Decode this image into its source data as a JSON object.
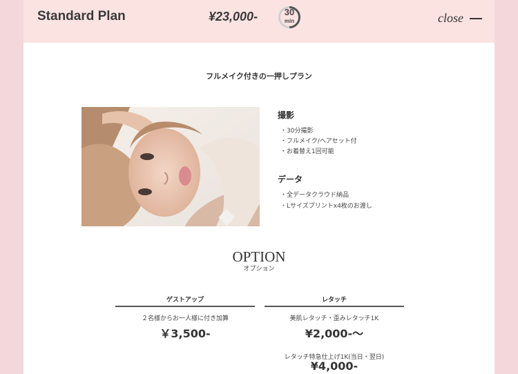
{
  "header": {
    "plan_name": "Standard Plan",
    "price": "¥23,000-",
    "duration_number": "30",
    "duration_unit": "min",
    "close_label": "close"
  },
  "subtitle": "フルメイク付きの一押しプラン",
  "shooting": {
    "title": "撮影",
    "items": [
      "・30分撮影",
      "・フルメイク/ヘアセット付",
      "・お着替え1回可能"
    ]
  },
  "data_section": {
    "title": "データ",
    "items": [
      "・全データクラウド納品",
      "・Lサイズプリントx4枚のお渡し"
    ]
  },
  "option": {
    "title": "OPTION",
    "subtitle": "オプション",
    "columns": [
      {
        "heading": "ゲストアップ",
        "entries": [
          {
            "desc": "２名様からお一人様に付き加算",
            "price": "￥3,500-"
          }
        ]
      },
      {
        "heading": "レタッチ",
        "entries": [
          {
            "desc": "美肌レタッチ・歪みレタッチ1K",
            "price": "¥2,000-〜"
          },
          {
            "desc": "レタッチ特急仕上げ1K(当日・翌日)",
            "price": "¥4,000-"
          }
        ]
      }
    ]
  },
  "colors": {
    "page_background": "#f6dde0",
    "header_background": "#fbe3e2",
    "panel_background": "#ffffff",
    "text": "#333333"
  }
}
